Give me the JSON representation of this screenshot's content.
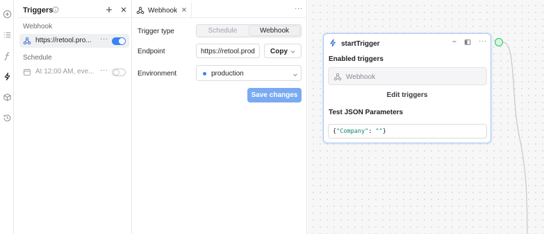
{
  "rail": {
    "icons": [
      "plus-circle-icon",
      "list-icon",
      "function-icon",
      "lightning-icon",
      "cube-icon",
      "history-icon"
    ]
  },
  "triggers_panel": {
    "title": "Triggers",
    "sections": [
      {
        "label": "Webhook",
        "items": [
          {
            "label": "https://retool.pro...",
            "enabled": true,
            "selected": true
          }
        ]
      },
      {
        "label": "Schedule",
        "items": [
          {
            "label": "At 12:00 AM, eve...",
            "enabled": false,
            "selected": false
          }
        ]
      }
    ],
    "more_label": "···"
  },
  "webhook_panel": {
    "tab_label": "Webhook",
    "more_label": "···",
    "trigger_type_label": "Trigger type",
    "trigger_type_options": [
      "Schedule",
      "Webhook"
    ],
    "trigger_type_selected": "Webhook",
    "endpoint_label": "Endpoint",
    "endpoint_value": "https://retool.prod",
    "copy_label": "Copy",
    "environment_label": "Environment",
    "environment_value": "production",
    "save_label": "Save changes"
  },
  "canvas": {
    "node": {
      "title": "startTrigger",
      "enabled_triggers_label": "Enabled triggers",
      "enabled_trigger": "Webhook",
      "edit_triggers_label": "Edit triggers",
      "test_json_label": "Test JSON Parameters",
      "json_key": "\"Company\"",
      "json_value": "\"\"",
      "more_label": "···"
    }
  },
  "colors": {
    "accent": "#3b82f6",
    "save_button": "#79aaf2",
    "port": "#22c55e",
    "node_border": "#a9c6f5"
  }
}
